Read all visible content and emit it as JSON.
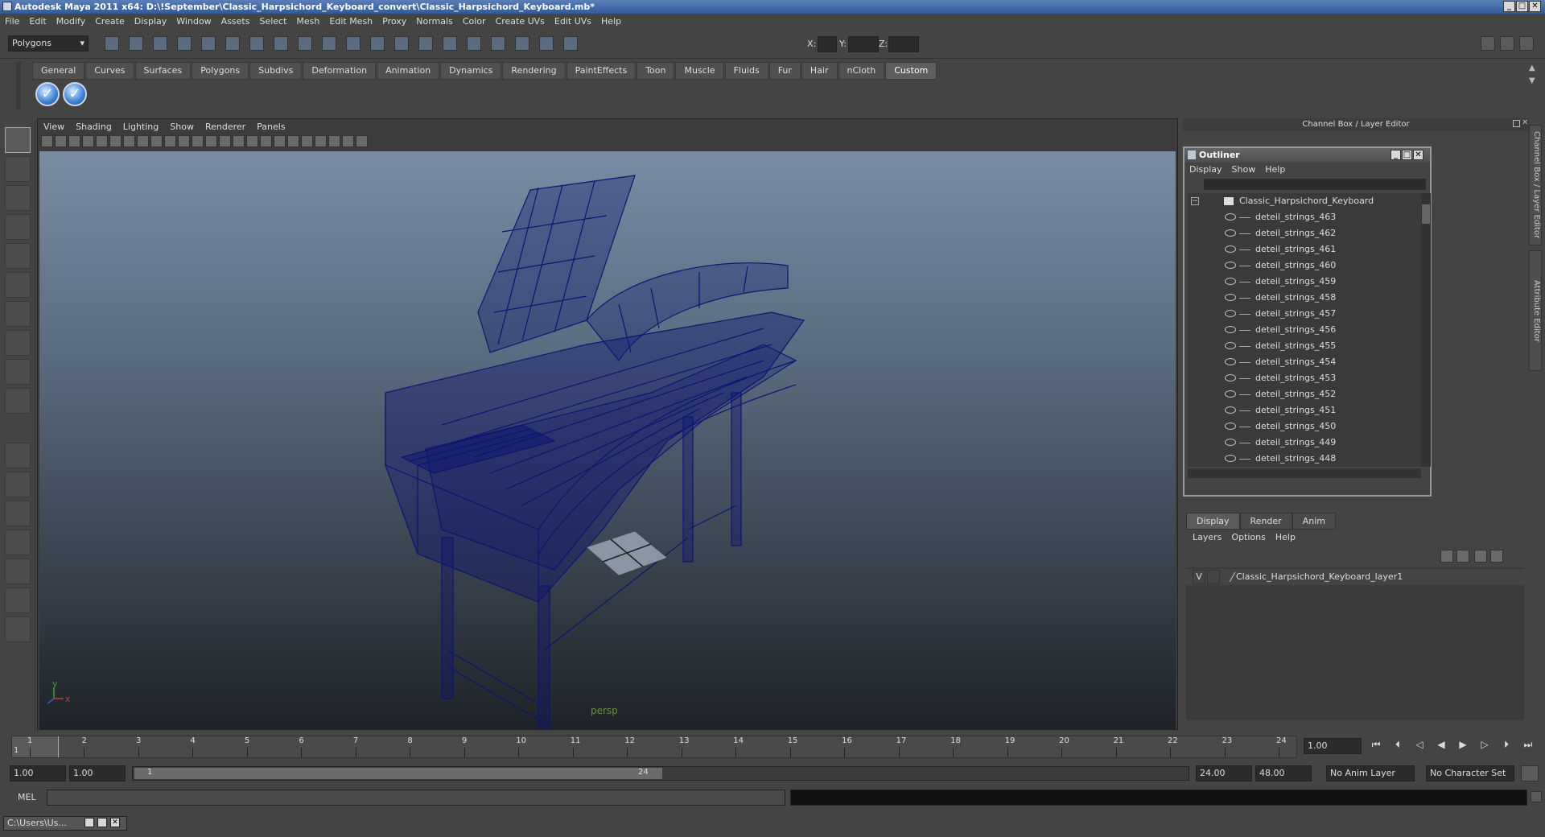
{
  "window": {
    "title": "Autodesk Maya 2011 x64: D:\\!September\\Classic_Harpsichord_Keyboard_convert\\Classic_Harpsichord_Keyboard.mb*"
  },
  "menubar": [
    "File",
    "Edit",
    "Modify",
    "Create",
    "Display",
    "Window",
    "Assets",
    "Select",
    "Mesh",
    "Edit Mesh",
    "Proxy",
    "Normals",
    "Color",
    "Create UVs",
    "Edit UVs",
    "Help"
  ],
  "statusline": {
    "menuset": "Polygons",
    "x_label": "X:",
    "y_label": "Y:",
    "z_label": "Z:"
  },
  "shelf": {
    "tabs": [
      "General",
      "Curves",
      "Surfaces",
      "Polygons",
      "Subdivs",
      "Deformation",
      "Animation",
      "Dynamics",
      "Rendering",
      "PaintEffects",
      "Toon",
      "Muscle",
      "Fluids",
      "Fur",
      "Hair",
      "nCloth",
      "Custom"
    ],
    "active_tab": "Custom"
  },
  "viewport": {
    "menu": [
      "View",
      "Shading",
      "Lighting",
      "Show",
      "Renderer",
      "Panels"
    ],
    "camera_label": "persp",
    "axis_x": "x",
    "axis_y": "y"
  },
  "right_panel": {
    "header": "Channel Box / Layer Editor",
    "side_tabs": [
      "Channel Box / Layer Editor",
      "Attribute Editor"
    ]
  },
  "outliner": {
    "title": "Outliner",
    "menu": [
      "Display",
      "Show",
      "Help"
    ],
    "root": "Classic_Harpsichord_Keyboard",
    "items": [
      "deteil_strings_463",
      "deteil_strings_462",
      "deteil_strings_461",
      "deteil_strings_460",
      "deteil_strings_459",
      "deteil_strings_458",
      "deteil_strings_457",
      "deteil_strings_456",
      "deteil_strings_455",
      "deteil_strings_454",
      "deteil_strings_453",
      "deteil_strings_452",
      "deteil_strings_451",
      "deteil_strings_450",
      "deteil_strings_449",
      "deteil_strings_448"
    ]
  },
  "layer_editor": {
    "tabs": [
      "Display",
      "Render",
      "Anim"
    ],
    "active_tab": "Display",
    "menu": [
      "Layers",
      "Options",
      "Help"
    ],
    "layer": {
      "visible": "V",
      "name": "Classic_Harpsichord_Keyboard_layer1"
    }
  },
  "timeline": {
    "ticks": [
      "1",
      "2",
      "3",
      "4",
      "5",
      "6",
      "7",
      "8",
      "9",
      "10",
      "11",
      "12",
      "13",
      "14",
      "15",
      "16",
      "17",
      "18",
      "19",
      "20",
      "21",
      "22",
      "23",
      "24"
    ],
    "current_frame": "1",
    "current_time_field": "1.00"
  },
  "range": {
    "start_time": "1.00",
    "playback_start": "1.00",
    "range_start_label": "1",
    "range_end_label": "24",
    "playback_end": "24.00",
    "end_time": "48.00",
    "anim_layer": "No Anim Layer",
    "character_set": "No Character Set"
  },
  "command_line": {
    "label": "MEL"
  },
  "taskbar": {
    "minimized_window": "C:\\Users\\Us..."
  },
  "colors": {
    "wireframe": "#0e1470",
    "titlebar": "#3d66a8",
    "ui_bg": "#444444"
  }
}
